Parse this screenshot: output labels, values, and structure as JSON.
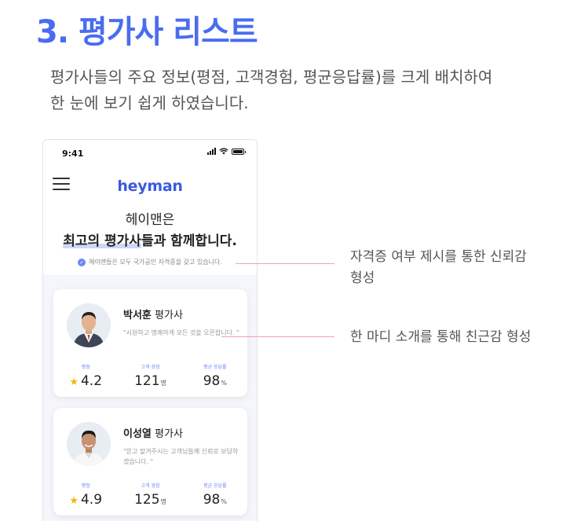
{
  "heading": "3. 평가사 리스트",
  "description": {
    "line1": "평가사들의 주요 정보(평점, 고객경험, 평균응답률)를 크게 배치하여",
    "line2": "한 눈에 보기 쉽게 하였습니다."
  },
  "phone": {
    "status_time": "9:41",
    "logo": "heyman",
    "hero_line1": "헤이맨은",
    "hero_line2_highlight": "최고의 평가사",
    "hero_line2_rest": "들과 함께합니다.",
    "cert_note": "헤이맨들은 모두 국가공인 자격증을 갖고 있습니다.",
    "appraisers": [
      {
        "name": "박서훈",
        "title": " 평가사",
        "quote": "\"시원하고 명쾌하게 모든 것을 오픈합니다. \"",
        "rating_label": "평점",
        "rating": "4.2",
        "experience_label": "고객 경험",
        "experience": "121",
        "experience_unit": "명",
        "response_label": "평균 응답률",
        "response": "98",
        "response_unit": "%"
      },
      {
        "name": "이성열",
        "title": " 평가사",
        "quote": "\"믿고 맡겨주시는 고객님들께 신뢰로 보답하겠습니다. \"",
        "rating_label": "평점",
        "rating": "4.9",
        "experience_label": "고객 경험",
        "experience": "125",
        "experience_unit": "명",
        "response_label": "평균 응답률",
        "response": "98",
        "response_unit": "%"
      }
    ]
  },
  "annotations": {
    "cert_line1": "자격증 여부 제시를 통한 신뢰감",
    "cert_line2": "형성",
    "quote": "한 마디 소개를 통해 친근감 형성"
  },
  "colors": {
    "accent": "#4a6cf0",
    "logo": "#3b5bdb",
    "star": "#f2b705",
    "annotation_line": "#f1a3ac"
  }
}
